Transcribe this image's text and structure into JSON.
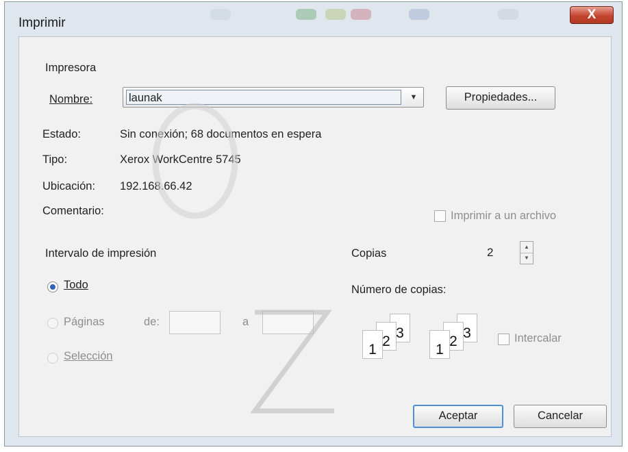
{
  "window": {
    "title": "Imprimir",
    "close_label": "X"
  },
  "printer": {
    "section_label": "Impresora",
    "name_label": "Nombre:",
    "name_value": "launak",
    "properties_button": "Propiedades...",
    "status_label": "Estado:",
    "status_value": "Sin conexión; 68 documentos en espera",
    "type_label": "Tipo:",
    "type_value": "Xerox WorkCentre 5745",
    "location_label": "Ubicación:",
    "location_value": "192.168.66.42",
    "comment_label": "Comentario:",
    "print_to_file_label": "Imprimir a un archivo"
  },
  "range": {
    "section_label": "Intervalo de impresión",
    "all_label": "Todo",
    "pages_label": "Páginas",
    "from_label": "de:",
    "to_label": "a",
    "selection_label": "Selección"
  },
  "copies": {
    "section_label": "Copias",
    "count_label": "Número de copias:",
    "count_value": "2",
    "collate_label": "Intercalar",
    "page_numbers": [
      "1",
      "2",
      "3"
    ]
  },
  "buttons": {
    "ok": "Aceptar",
    "cancel": "Cancelar"
  },
  "colors": {
    "accent": "#2f63b3",
    "close_button": "#c5452f",
    "default_button_border": "#4d90d5"
  }
}
